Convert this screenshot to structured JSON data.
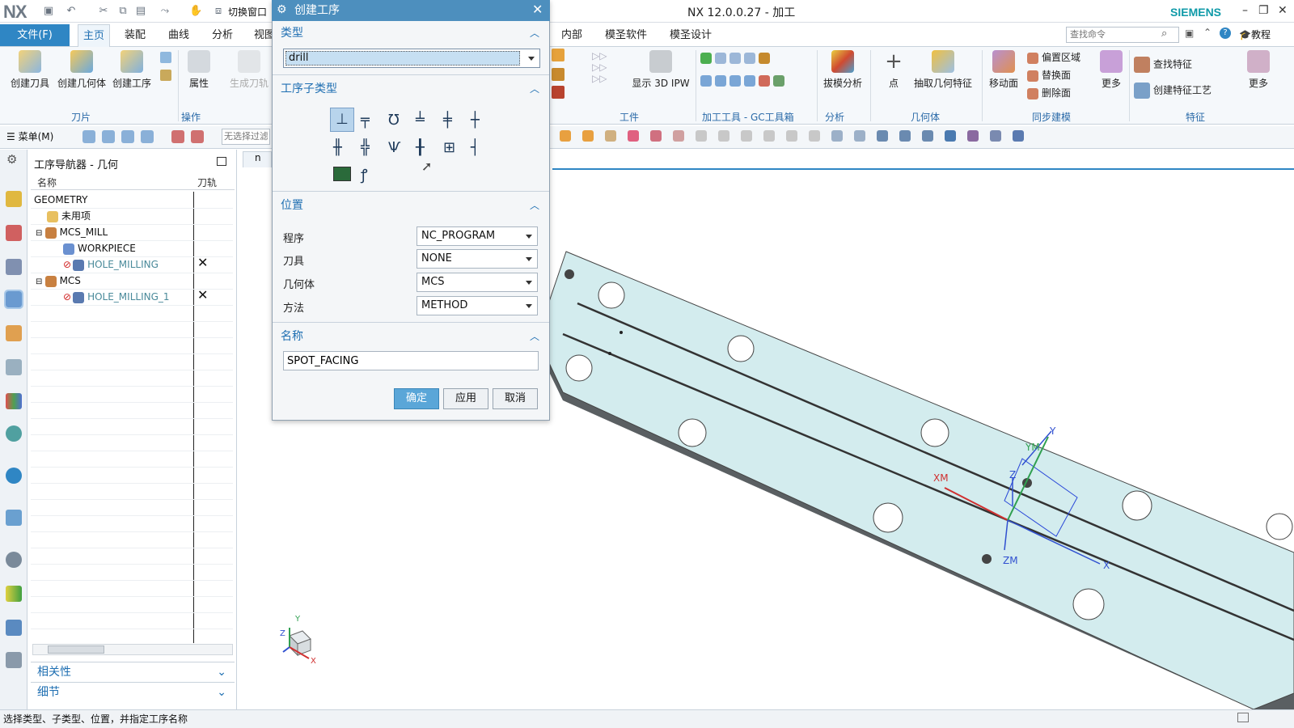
{
  "titlebar": {
    "logo": "NX",
    "title": "NX 12.0.0.27 - 加工",
    "brand": "SIEMENS",
    "switch_window": "切换窗口"
  },
  "ribbon_tabs": [
    "文件(F)",
    "主页",
    "装配",
    "曲线",
    "分析",
    "视图",
    "内部",
    "模圣软件",
    "模圣设计"
  ],
  "search": {
    "placeholder": "查找命令"
  },
  "help_label": "教程",
  "ribbon": {
    "create_tool": "创建刀具",
    "create_geometry": "创建几何体",
    "create_operation": "创建工序",
    "properties": "属性",
    "generate_path": "生成刀轨",
    "show_ipw": "显示 3D IPW",
    "draft_analysis": "拔模分析",
    "point": "点",
    "extract_geom": "抽取几何特征",
    "move_face": "移动面",
    "offset_region": "偏置区域",
    "replace_face": "替换面",
    "delete_face": "删除面",
    "more1": "更多",
    "find_feature": "查找特征",
    "create_feature_process": "创建特征工艺",
    "more2": "更多",
    "groups": {
      "tools": "刀片",
      "ops": "操作",
      "workpiece": "工件",
      "machining_tools": "加工工具 - GC工具箱",
      "analysis": "分析",
      "geometry": "几何体",
      "sync": "同步建模",
      "feature": "特征"
    }
  },
  "toolbar2": {
    "menu": "菜单(M)",
    "filter": "无选择过滤器"
  },
  "navigator": {
    "title": "工序导航器 - 几何",
    "col_name": "名称",
    "col_path": "刀轨",
    "rows": [
      {
        "label": "GEOMETRY"
      },
      {
        "label": "未用项"
      },
      {
        "label": "MCS_MILL"
      },
      {
        "label": "WORKPIECE"
      },
      {
        "label": "HOLE_MILLING",
        "mark": "✕"
      },
      {
        "label": "MCS"
      },
      {
        "label": "HOLE_MILLING_1",
        "mark": "✕"
      }
    ],
    "related": "相关性",
    "details": "细节"
  },
  "dialog": {
    "title": "创建工序",
    "type_header": "类型",
    "type_value": "drill",
    "subtype_header": "工序子类型",
    "location_header": "位置",
    "program_label": "程序",
    "program_value": "NC_PROGRAM",
    "tool_label": "刀具",
    "tool_value": "NONE",
    "geometry_label": "几何体",
    "geometry_value": "MCS",
    "method_label": "方法",
    "method_value": "METHOD",
    "name_header": "名称",
    "name_value": "SPOT_FACING",
    "ok": "确定",
    "apply": "应用",
    "cancel": "取消"
  },
  "viewport": {
    "tab": "n",
    "labels": {
      "y": "Y",
      "ym": "YM",
      "xm": "XM",
      "x": "X",
      "z": "Z",
      "zm": "ZM"
    }
  },
  "triad": {
    "x": "X",
    "y": "Y",
    "z": "Z"
  },
  "status": "选择类型、子类型、位置，并指定工序名称",
  "colors": {
    "accent": "#2f86c4",
    "part": "#cfe8ec",
    "part_side": "#5a5f62",
    "error": "#d02020"
  }
}
